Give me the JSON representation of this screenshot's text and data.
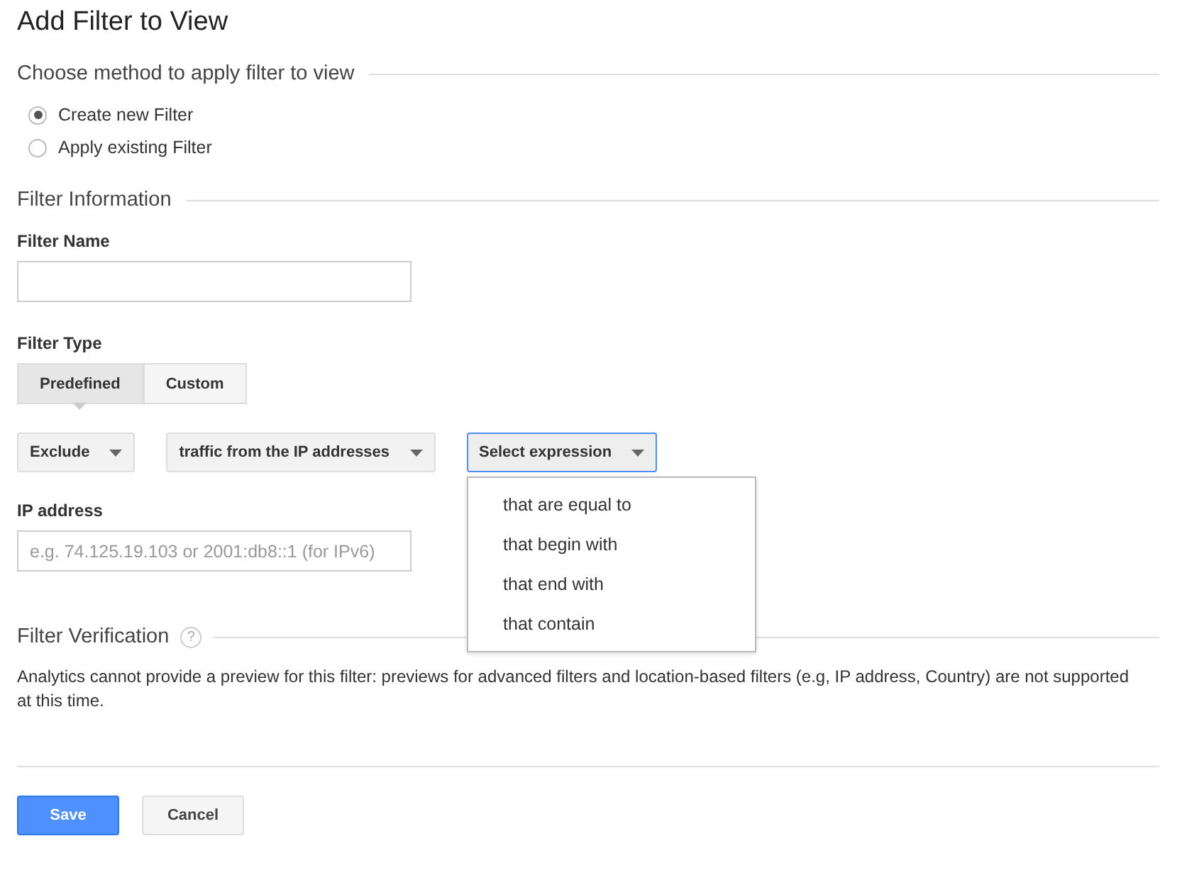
{
  "title": "Add Filter to View",
  "method_section": {
    "heading": "Choose method to apply filter to view",
    "options": [
      {
        "label": "Create new Filter",
        "selected": true
      },
      {
        "label": "Apply existing Filter",
        "selected": false
      }
    ]
  },
  "info_section": {
    "heading": "Filter Information",
    "name_label": "Filter Name",
    "type_label": "Filter Type",
    "type_tabs": [
      {
        "label": "Predefined",
        "selected": true
      },
      {
        "label": "Custom",
        "selected": false
      }
    ],
    "selects": [
      {
        "value": "Exclude",
        "open": false
      },
      {
        "value": "traffic from the IP addresses",
        "open": false
      },
      {
        "value": "Select expression",
        "open": true,
        "options": [
          "that are equal to",
          "that begin with",
          "that end with",
          "that contain"
        ]
      }
    ],
    "ip_label": "IP address",
    "ip_placeholder": "e.g. 74.125.19.103 or 2001:db8::1 (for IPv6)"
  },
  "verification": {
    "heading": "Filter Verification",
    "help_glyph": "?",
    "text": "Analytics cannot provide a preview for this filter: previews for advanced filters and location-based filters (e.g, IP address, Country) are not supported at this time."
  },
  "buttons": [
    {
      "label": "Save",
      "kind": "primary"
    },
    {
      "label": "Cancel",
      "kind": "secondary"
    }
  ]
}
